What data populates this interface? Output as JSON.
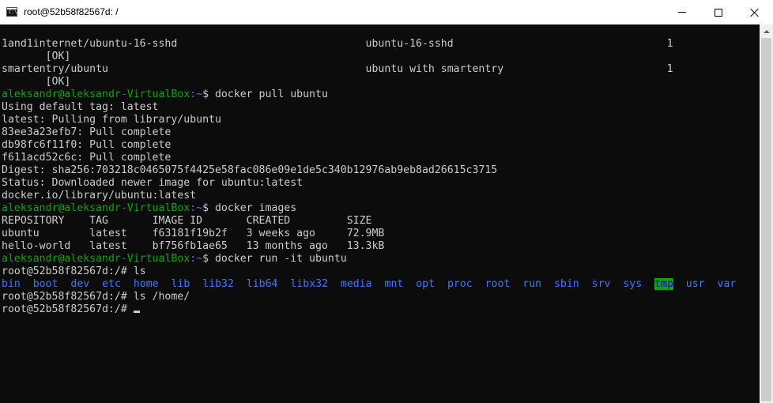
{
  "window": {
    "title": "root@52b58f82567d: /",
    "app_icon_text": "C:\\"
  },
  "terminal": {
    "search_rows": [
      {
        "name": "1and1internet/ubuntu-16-sshd",
        "desc": "ubuntu-16-sshd",
        "stars": "1",
        "automated": "[OK]"
      },
      {
        "name": "smartentry/ubuntu",
        "desc": "ubuntu with smartentry",
        "stars": "1",
        "automated": "[OK]"
      }
    ],
    "prompt_user": "aleksandr@aleksandr-VirtualBox",
    "prompt_path": ":~",
    "prompt_symbol": "$ ",
    "cmd_pull": "docker pull ubuntu",
    "pull_output": [
      "Using default tag: latest",
      "latest: Pulling from library/ubuntu",
      "83ee3a23efb7: Pull complete",
      "db98fc6f11f0: Pull complete",
      "f611acd52c6c: Pull complete",
      "Digest: sha256:703218c0465075f4425e58fac086e09e1de5c340b12976ab9eb8ad26615c3715",
      "Status: Downloaded newer image for ubuntu:latest",
      "docker.io/library/ubuntu:latest"
    ],
    "cmd_images": "docker images",
    "images_header": [
      "REPOSITORY",
      "TAG",
      "IMAGE ID",
      "CREATED",
      "SIZE"
    ],
    "images": [
      [
        "ubuntu",
        "latest",
        "f63181f19b2f",
        "3 weeks ago",
        "72.9MB"
      ],
      [
        "hello-world",
        "latest",
        "bf756fb1ae65",
        "13 months ago",
        "13.3kB"
      ]
    ],
    "cmd_run": "docker run -it ubuntu",
    "root_prompt": "root@52b58f82567d:/# ",
    "cmd_ls": "ls",
    "ls_dirs": [
      "bin",
      "boot",
      "dev",
      "etc",
      "home",
      "lib",
      "lib32",
      "lib64",
      "libx32",
      "media",
      "mnt",
      "opt",
      "proc",
      "root",
      "run",
      "sbin",
      "srv",
      "sys",
      "tmp",
      "usr",
      "var"
    ],
    "cmd_ls_home": "ls /home/",
    "colors": {
      "green": "#13a10e",
      "blue": "#3b78ff",
      "text": "#cccccc",
      "background": "#0c0c0c"
    }
  }
}
